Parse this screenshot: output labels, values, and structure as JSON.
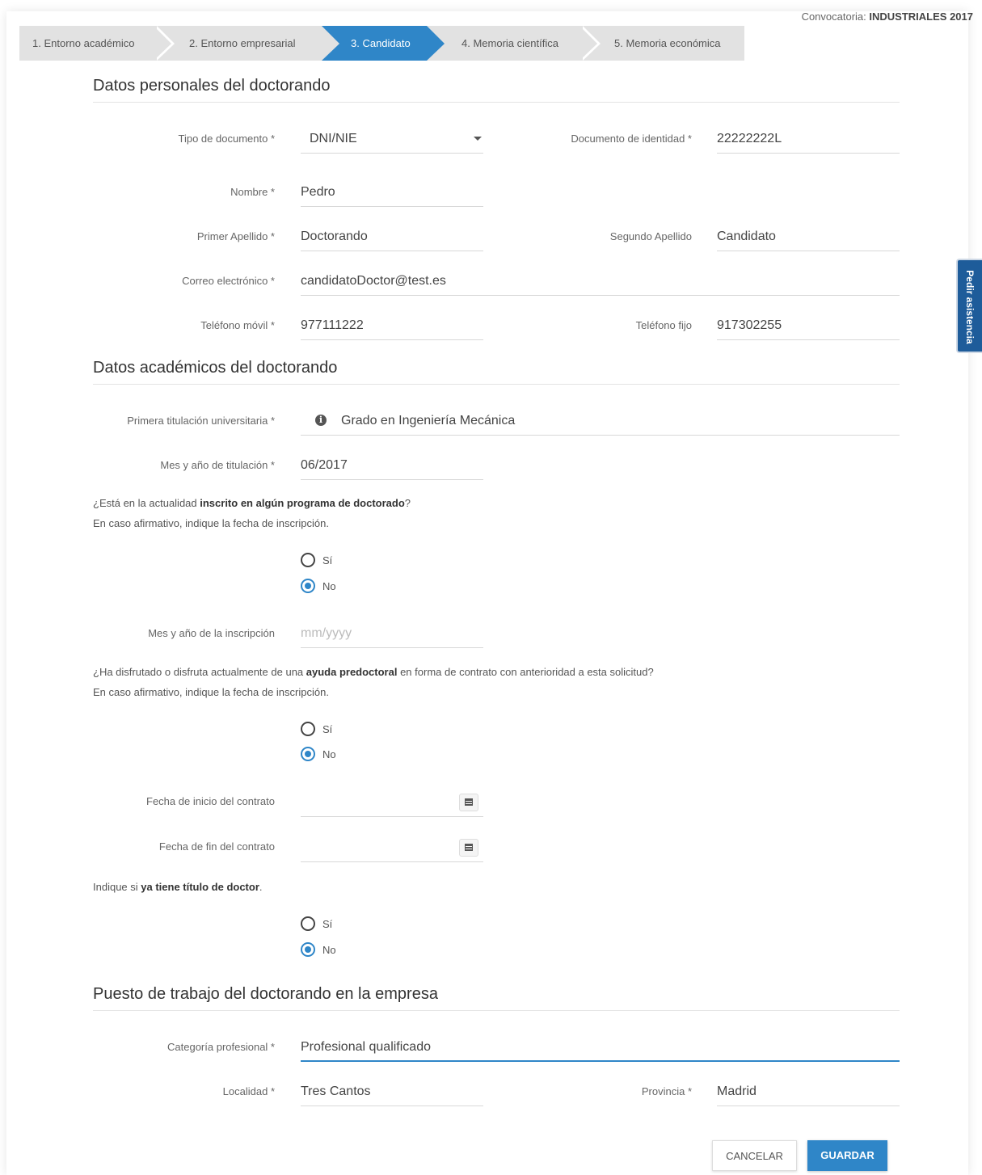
{
  "convocatoria": {
    "label": "Convocatoria:",
    "value": "INDUSTRIALES 2017"
  },
  "steps": [
    {
      "label": "1. Entorno académico",
      "active": false
    },
    {
      "label": "2. Entorno empresarial",
      "active": false
    },
    {
      "label": "3. Candidato",
      "active": true
    },
    {
      "label": "4. Memoria científica",
      "active": false
    },
    {
      "label": "5. Memoria económica",
      "active": false
    }
  ],
  "help_tab": "Pedir asistencia",
  "personal": {
    "title": "Datos personales del doctorando",
    "tipo_documento": {
      "label": "Tipo de documento *",
      "value": "DNI/NIE"
    },
    "documento": {
      "label": "Documento de identidad *",
      "value": "22222222L"
    },
    "nombre": {
      "label": "Nombre *",
      "value": "Pedro"
    },
    "primer_apellido": {
      "label": "Primer Apellido *",
      "value": "Doctorando"
    },
    "segundo_apellido": {
      "label": "Segundo Apellido",
      "value": "Candidato"
    },
    "correo": {
      "label": "Correo electrónico *",
      "value": "candidatoDoctor@test.es"
    },
    "movil": {
      "label": "Teléfono móvil *",
      "value": "977111222"
    },
    "fijo": {
      "label": "Teléfono fijo",
      "value": "917302255"
    }
  },
  "academic": {
    "title": "Datos académicos del doctorando",
    "titulacion": {
      "label": "Primera titulación universitaria *",
      "value": "Grado en Ingeniería Mecánica"
    },
    "mes_titulacion": {
      "label": "Mes y año de titulación *",
      "value": "06/2017"
    },
    "q1": {
      "pre": "¿Está en la actualidad ",
      "bold": "inscrito en algún programa de doctorado",
      "post": "?",
      "line2": "En caso afirmativo, indique la fecha de inscripción."
    },
    "q1_options": {
      "yes": "Sí",
      "no": "No",
      "selected": "No"
    },
    "inscripcion": {
      "label": "Mes y año de la inscripción",
      "placeholder": "mm/yyyy"
    },
    "q2": {
      "pre": "¿Ha disfrutado o disfruta actualmente de una ",
      "bold": "ayuda predoctoral",
      "post": " en forma de contrato con anterioridad a esta solicitud?",
      "line2": "En caso afirmativo, indique la fecha de inscripción."
    },
    "q2_options": {
      "yes": "Sí",
      "no": "No",
      "selected": "No"
    },
    "inicio_contrato": {
      "label": "Fecha de inicio del contrato",
      "value": ""
    },
    "fin_contrato": {
      "label": "Fecha de fin del contrato",
      "value": ""
    },
    "q3": {
      "pre": "Indique si ",
      "bold": "ya tiene título de doctor",
      "post": "."
    },
    "q3_options": {
      "yes": "Sí",
      "no": "No",
      "selected": "No"
    }
  },
  "job": {
    "title": "Puesto de trabajo del doctorando en la empresa",
    "categoria": {
      "label": "Categoría profesional *",
      "value": "Profesional qualificado"
    },
    "localidad": {
      "label": "Localidad *",
      "value": "Tres Cantos"
    },
    "provincia": {
      "label": "Provincia *",
      "value": "Madrid"
    }
  },
  "buttons": {
    "cancel": "CANCELAR",
    "save": "GUARDAR"
  },
  "colors": {
    "accent": "#2f86c8",
    "help_tab": "#1e5c9a"
  }
}
